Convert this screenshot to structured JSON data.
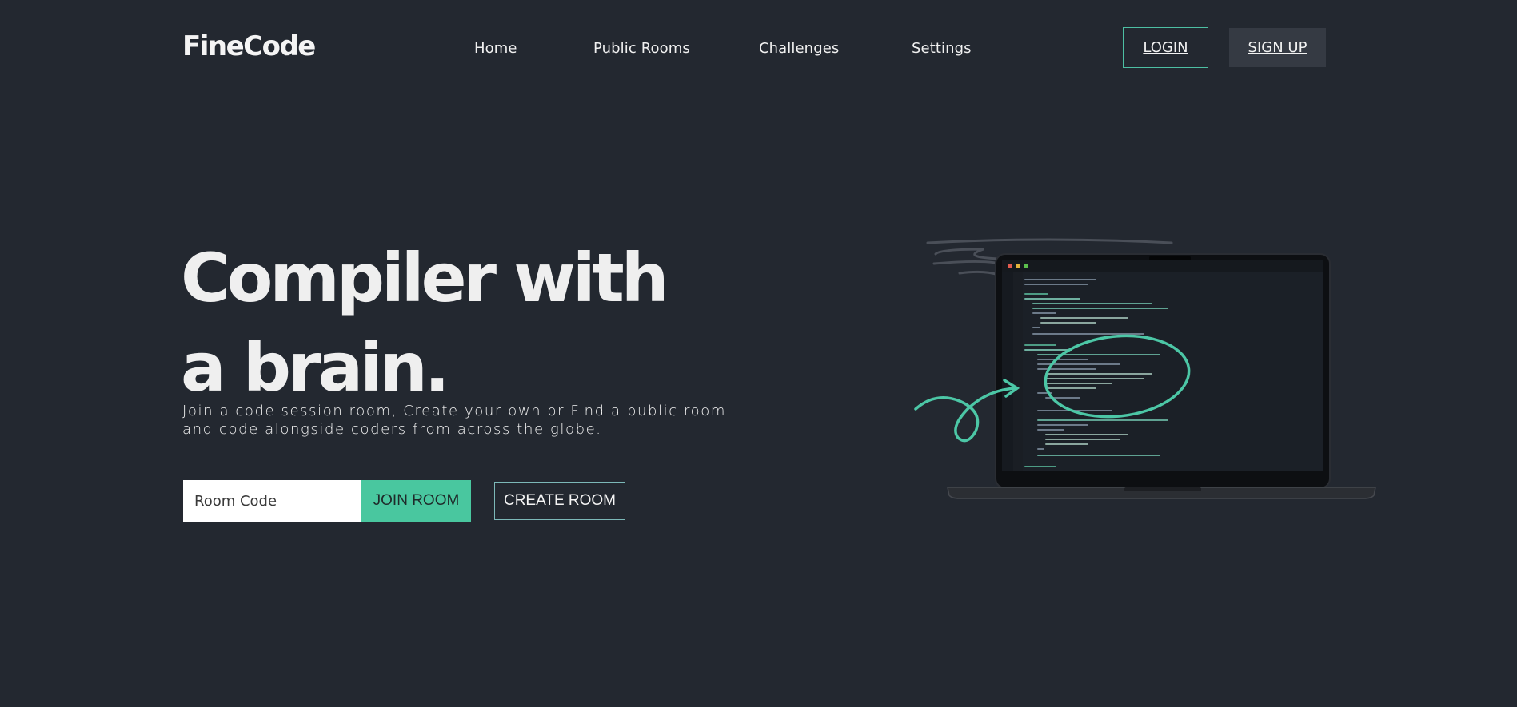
{
  "header": {
    "logo": "FineCode",
    "nav": [
      {
        "label": "Home"
      },
      {
        "label": "Public Rooms"
      },
      {
        "label": "Challenges"
      },
      {
        "label": "Settings"
      }
    ],
    "login_label": "LOGIN",
    "signup_label": "SIGN UP"
  },
  "hero": {
    "title_line1": "Compiler with",
    "title_line2": "a brain.",
    "subtitle_line1": "Join a code session room, Create your own or Find a public room",
    "subtitle_line2": "and code alongside coders from across the globe.",
    "room_code_placeholder": "Room Code",
    "join_label": "JOIN ROOM",
    "create_label": "CREATE ROOM"
  },
  "illustration": {
    "laptop_icon": "laptop-with-code-icon",
    "arrow_icon": "curly-arrow-icon",
    "circle_icon": "hand-drawn-circle-icon"
  },
  "colors": {
    "background": "#232830",
    "accent": "#49c79f",
    "signup_bg": "#353a43",
    "text": "#f2f2f2"
  }
}
